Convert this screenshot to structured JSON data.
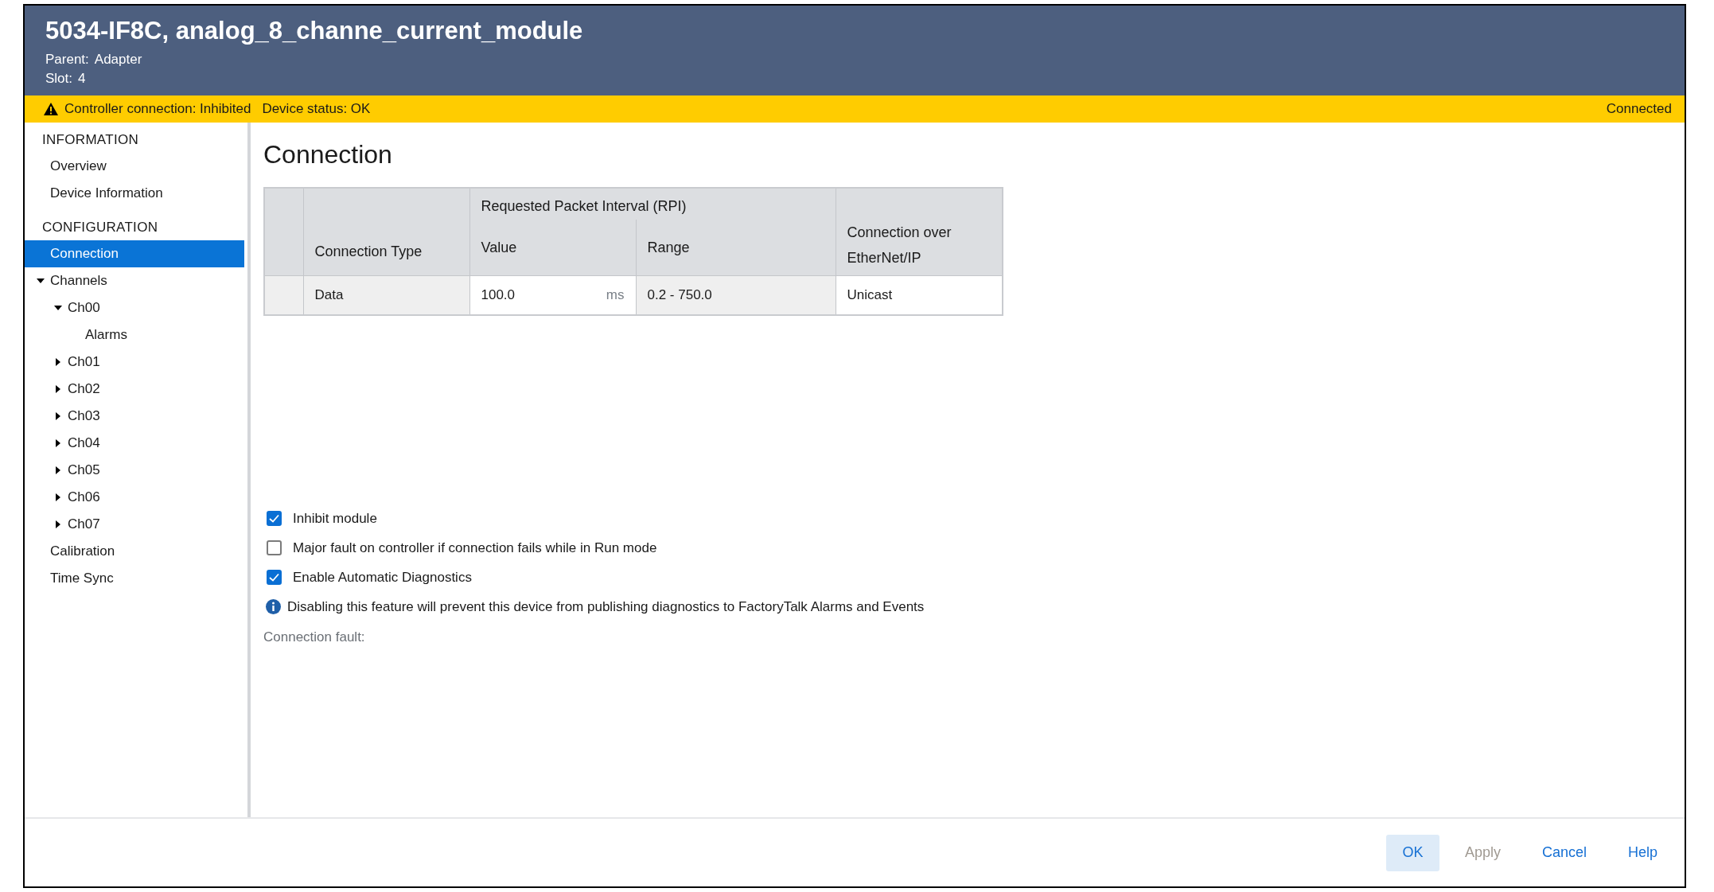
{
  "header": {
    "title": "5034-IF8C, analog_8_channe_current_module",
    "parent_label": "Parent:",
    "parent": "Adapter",
    "slot_label": "Slot:",
    "slot": "4"
  },
  "status_bar": {
    "controller_connection": "Controller connection: Inhibited",
    "device_status": "Device status: OK",
    "online": "Connected"
  },
  "sidebar": {
    "sections": [
      {
        "heading": "INFORMATION",
        "items": [
          {
            "label": "Overview",
            "selected": false
          },
          {
            "label": "Device Information",
            "selected": false
          }
        ]
      },
      {
        "heading": "CONFIGURATION",
        "items": [
          {
            "label": "Connection",
            "selected": true
          },
          {
            "label": "Channels",
            "expanded": true,
            "selected": false,
            "children": [
              {
                "label": "Ch00",
                "expanded": true,
                "selected": false,
                "children": [
                  {
                    "label": "Alarms",
                    "selected": false
                  }
                ]
              },
              {
                "label": "Ch01",
                "expanded": false,
                "selected": false
              },
              {
                "label": "Ch02",
                "expanded": false,
                "selected": false
              },
              {
                "label": "Ch03",
                "expanded": false,
                "selected": false
              },
              {
                "label": "Ch04",
                "expanded": false,
                "selected": false
              },
              {
                "label": "Ch05",
                "expanded": false,
                "selected": false
              },
              {
                "label": "Ch06",
                "expanded": false,
                "selected": false
              },
              {
                "label": "Ch07",
                "expanded": false,
                "selected": false
              }
            ]
          },
          {
            "label": "Calibration",
            "selected": false
          },
          {
            "label": "Time Sync",
            "selected": false
          }
        ]
      }
    ]
  },
  "content": {
    "title": "Connection",
    "table": {
      "group_header": "Requested Packet Interval (RPI)",
      "columns": [
        "Connection Type",
        "Value",
        "Range",
        "Connection over EtherNet/IP"
      ],
      "rows": [
        {
          "type": "Data",
          "value": "100.0",
          "unit": "ms",
          "range": "0.2 - 750.0",
          "connection": "Unicast"
        }
      ]
    },
    "options": [
      {
        "label": "Inhibit module",
        "checked": true
      },
      {
        "label": "Major fault on controller if connection fails while in Run mode",
        "checked": false
      },
      {
        "label": "Enable Automatic Diagnostics",
        "checked": true
      }
    ],
    "info_note": "Disabling this feature will prevent this device from publishing diagnostics to FactoryTalk Alarms and Events",
    "fault_label": "Connection fault:"
  },
  "buttons": [
    {
      "label": "OK",
      "default": true,
      "disabled": false
    },
    {
      "label": "Apply",
      "default": false,
      "disabled": true
    },
    {
      "label": "Cancel",
      "default": false,
      "disabled": false
    },
    {
      "label": "Help",
      "default": false,
      "disabled": false
    }
  ]
}
